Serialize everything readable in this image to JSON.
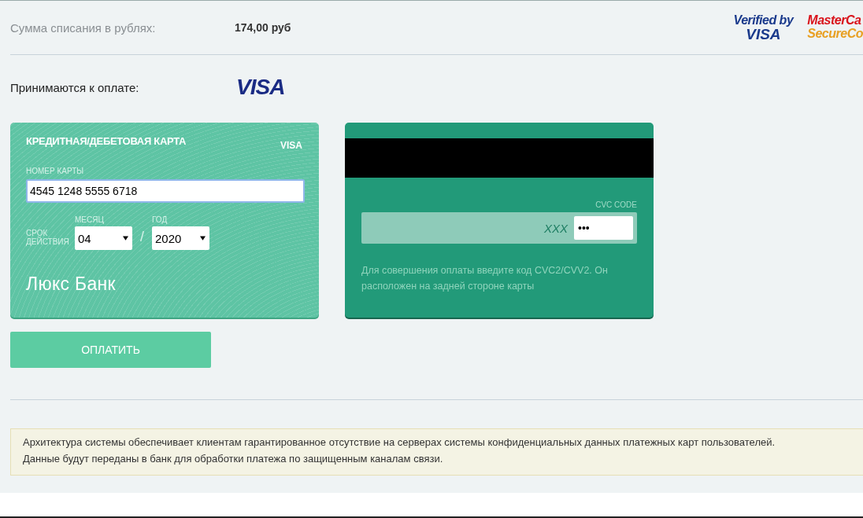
{
  "summary": {
    "label": "Сумма списания в рублях:",
    "amount": "174,00 руб"
  },
  "security_logos": [
    {
      "kind": "verified",
      "lines": [
        "Verified by",
        "VISA"
      ]
    },
    {
      "kind": "securecode",
      "lines": [
        "MasterCa",
        "SecureCo"
      ]
    }
  ],
  "accepted": {
    "label": "Принимаются к оплате:",
    "logo": "VISA"
  },
  "card_front": {
    "title": "КРЕДИТНАЯ/ДЕБЕТОВАЯ КАРТА",
    "brand": "VISA",
    "number_label": "НОМЕР КАРТЫ",
    "number_value": "4545 1248 5555 6718",
    "expiry_label": "СРОК ДЕЙСТВИЯ",
    "month_label": "МЕСЯЦ",
    "month_value": "04",
    "separator": "/",
    "year_label": "ГОД",
    "year_value": "2020",
    "bank_name": "Люкс Банк"
  },
  "card_back": {
    "cvc_label": "CVC CODE",
    "cvc_hint": "XXX",
    "cvc_value": "•••",
    "help": "Для совершения оплаты введите код CVC2/CVV2. Он расположен на задней стороне карты"
  },
  "pay_button": "ОПЛАТИТЬ",
  "notice": [
    "Архитектура системы обеспечивает клиентам гарантированное отсутствие на серверах системы конфиденциальных данных платежных карт пользователей.",
    "Данные будут переданы в банк для обработки платежа по защищенным каналам связи."
  ]
}
